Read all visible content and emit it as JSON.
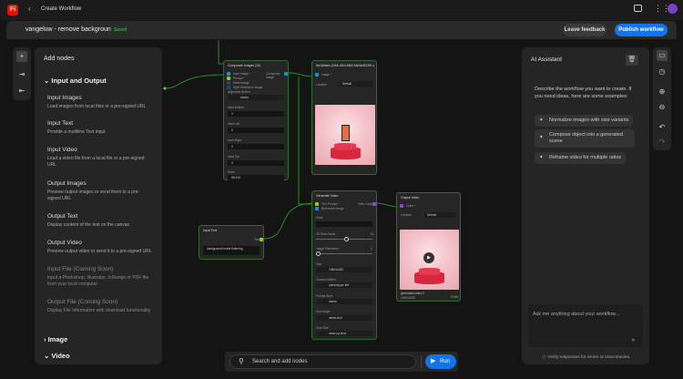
{
  "app": {
    "logo": "Fi",
    "title": "Create Workflow"
  },
  "header": {
    "workflow_name": "vangeluw - remove background",
    "status": "Saved",
    "feedback": "Leave feedback",
    "publish": "Publish workflow"
  },
  "add_nodes": {
    "title": "Add nodes",
    "sections": [
      {
        "label": "Input and Output",
        "expanded": true
      },
      {
        "label": "Image",
        "expanded": false
      },
      {
        "label": "Video",
        "expanded": true
      }
    ],
    "items": [
      {
        "name": "Input Images",
        "desc": "Load images from local files or a pre-signed URL"
      },
      {
        "name": "Input Text",
        "desc": "Provide a multiline Text input"
      },
      {
        "name": "Input Video",
        "desc": "Load a video file from a local file or a pre-signed URL"
      },
      {
        "name": "Output Images",
        "desc": "Preview output images or send them to a pre-signed URL"
      },
      {
        "name": "Output Text",
        "desc": "Display content of the text on the canvas"
      },
      {
        "name": "Output Video",
        "desc": "Preview output video or send it to a pre-signed URL"
      },
      {
        "name": "Input File (Coming Soon)",
        "desc": "Input a Photoshop, Illustrator, InDesign or PDF file from your local computer"
      },
      {
        "name": "Output File (Coming Soon)",
        "desc": "Display File Information with download functionality"
      }
    ]
  },
  "nodes": {
    "composite": {
      "title": "Composite Images (20)",
      "inputs": [
        "Input Image *",
        "Prompt *",
        "Mask Image",
        "Style Reference Image"
      ],
      "output": "Composite Image",
      "anchor_label": "Alignment Anchor",
      "anchor": "center",
      "fields": [
        {
          "label": "Inset Bottom",
          "value": "0"
        },
        {
          "label": "Inset Left",
          "value": "0"
        },
        {
          "label": "Inset Right",
          "value": "0"
        },
        {
          "label": "Inset Top",
          "value": "0"
        },
        {
          "label": "Seed",
          "value": "88,334"
        }
      ]
    },
    "output_image": {
      "title": "9e2a9bee-2045-4f13-b60f-94d1b6f23f9 no bg composite",
      "input": "Image *",
      "location_label": "Location",
      "location": "Default"
    },
    "input_text": {
      "title": "Input Text",
      "output": "Text",
      "value": "background hearts fluttering"
    },
    "generate_video": {
      "title": "Generate Video",
      "inputs": [
        "Text Prompt *",
        "Reference Image"
      ],
      "output": "Video Output",
      "seed_label": "Seed",
      "slider1_label": "3D Data Factor",
      "slider1_value": "50",
      "slider1_fraction": 0.5,
      "slider2_label": "Image Placement",
      "slider2_value": "0",
      "slider2_fraction": 0,
      "selects": [
        {
          "label": "Size",
          "value": "1080x1080"
        },
        {
          "label": "Camera Motion",
          "value": "camera pan left"
        },
        {
          "label": "Prompt Style",
          "value": "anime"
        },
        {
          "label": "Shot Angle",
          "value": "aerial shot"
        },
        {
          "label": "Shot Size",
          "value": "close-up shot"
        }
      ]
    },
    "output_video": {
      "title": "Output Video",
      "input": "Video *",
      "location_label": "Location",
      "location": "Default",
      "file": "generated-video-0",
      "meta": "1080x1080",
      "badge": "Public"
    }
  },
  "ai": {
    "title": "AI Assistant",
    "intro": "Describe the workflow you want to create. If you need ideas, here are some examples:",
    "examples": [
      "Normalize images with size variants",
      "Compose object into a generated scene",
      "Reframe video for multiple ratios"
    ],
    "placeholder": "Ask me anything about your workflow...",
    "disclaimer": "Verify responses for errors or inaccuracies."
  },
  "bottom": {
    "search_placeholder": "Search and add nodes",
    "run": "Run"
  }
}
